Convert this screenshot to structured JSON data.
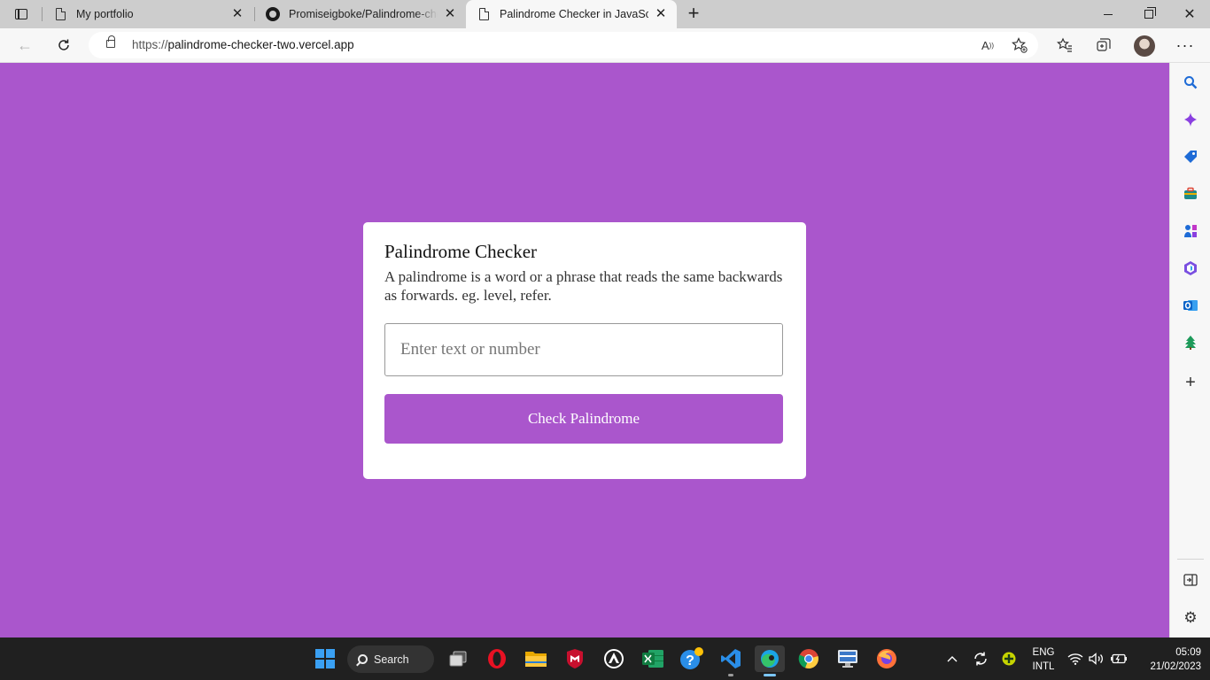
{
  "browser": {
    "tabs": [
      {
        "title": "My portfolio",
        "icon": "page-icon",
        "active": false
      },
      {
        "title": "Promiseigboke/Palindrome-checker",
        "icon": "github-icon",
        "active": false
      },
      {
        "title": "Palindrome Checker in JavaScript",
        "icon": "page-icon",
        "active": true
      }
    ],
    "new_tab_label": "+",
    "address": {
      "scheme": "https://",
      "host_path": "palindrome-checker-two.vercel.app"
    },
    "more_label": "···"
  },
  "page": {
    "background_color": "#aa56cc",
    "card": {
      "title": "Palindrome Checker",
      "description": "A palindrome is a word or a phrase that reads the same backwards as forwards. eg. level, refer.",
      "input_placeholder": "Enter text or number",
      "input_value": "",
      "button_label": "Check Palindrome",
      "button_color": "#aa56cc"
    }
  },
  "sidebar": {
    "items": [
      "search-icon",
      "copilot-icon",
      "shopping-tag-icon",
      "tools-icon",
      "games-icon",
      "office-icon",
      "outlook-icon",
      "tree-icon",
      "add-icon"
    ],
    "bottom": [
      "split-screen-icon",
      "settings-icon"
    ]
  },
  "taskbar": {
    "search_label": "Search",
    "apps": [
      "start-icon",
      "task-view-icon",
      "opera-icon",
      "file-explorer-icon",
      "mcafee-icon",
      "app-icon",
      "excel-icon",
      "help-icon",
      "vscode-icon",
      "edge-icon",
      "chrome-icon",
      "remote-desktop-icon",
      "firefox-icon"
    ],
    "language": "ENG",
    "layout": "INTL",
    "time": "05:09",
    "date": "21/02/2023"
  }
}
